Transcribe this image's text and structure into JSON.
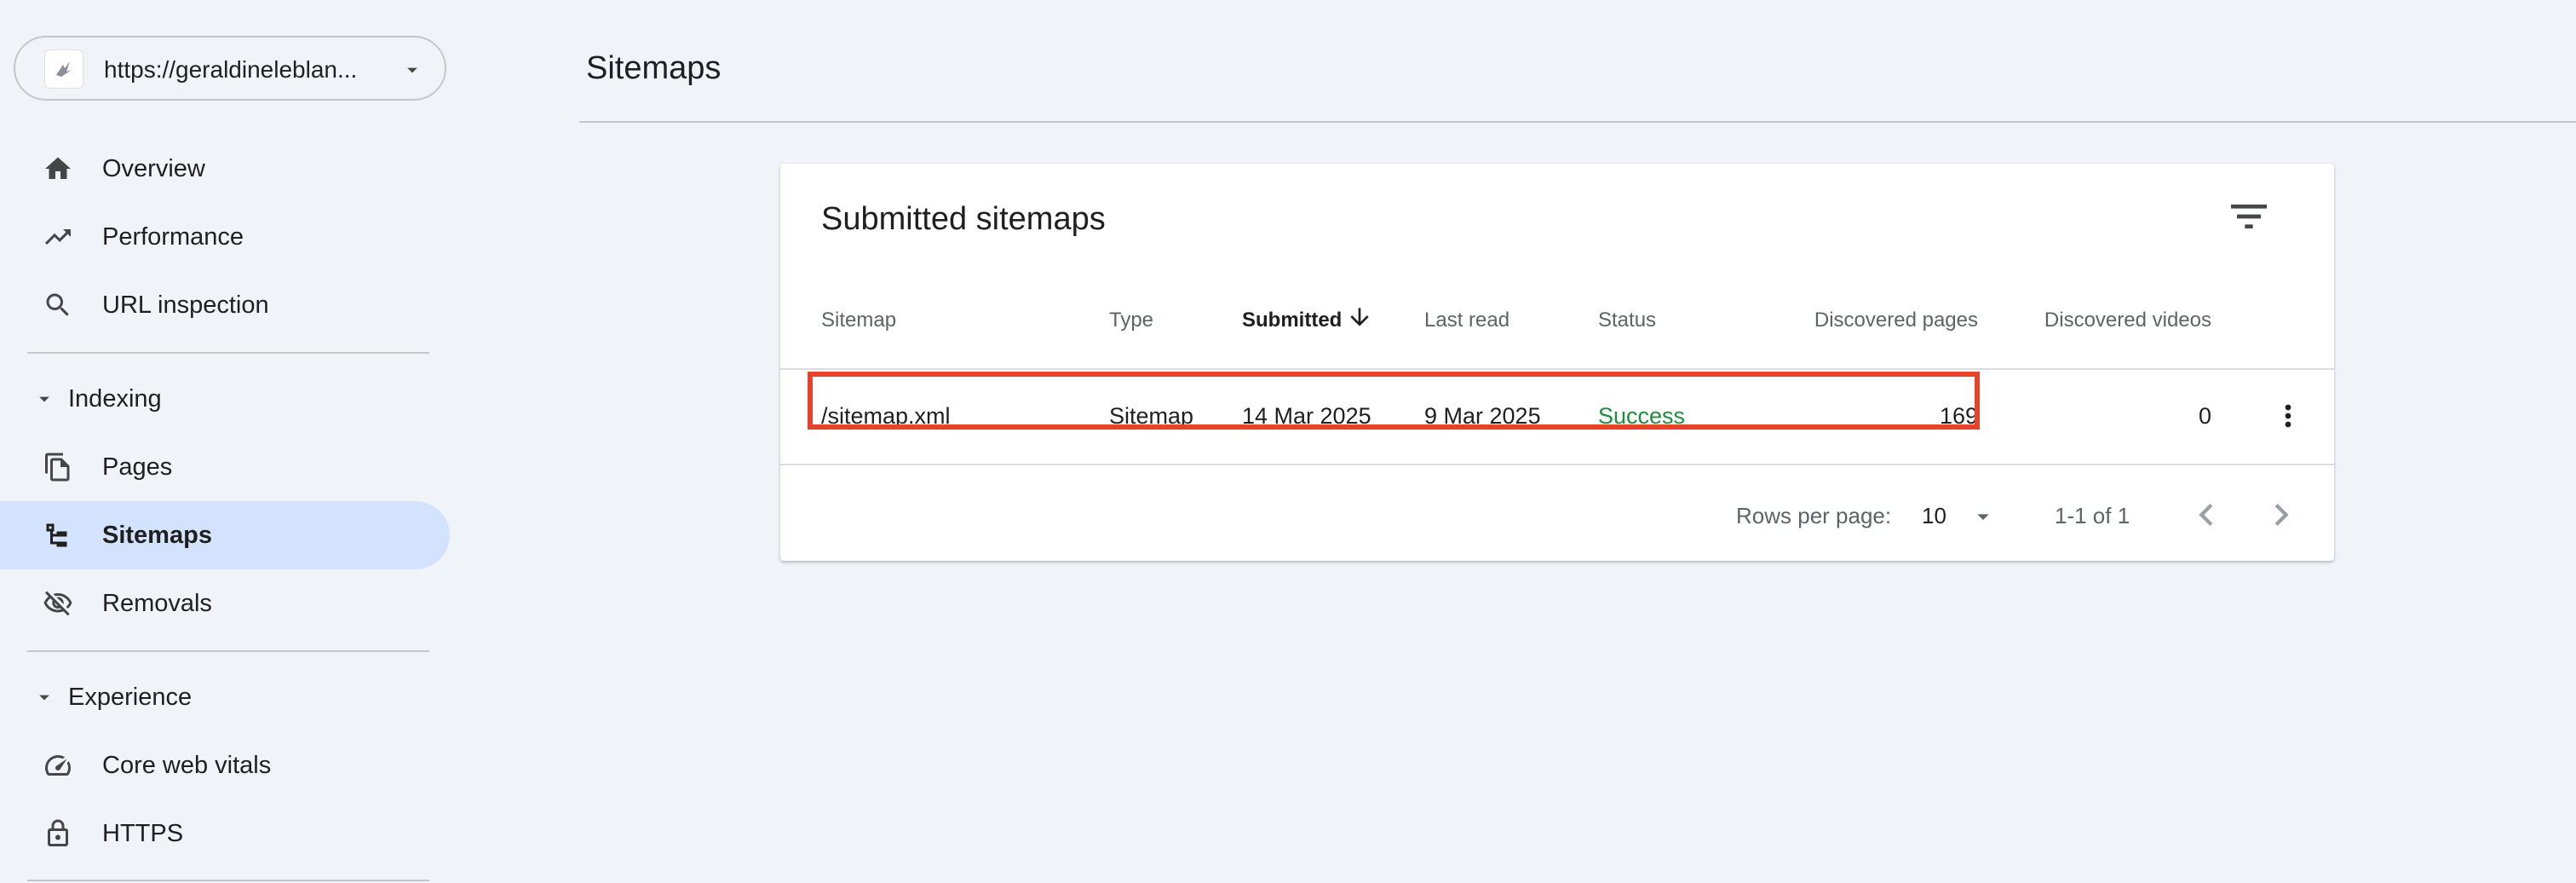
{
  "property": {
    "url": "https://geraldineleblan...",
    "logo_icon": "property-favicon-icon",
    "dropdown_icon": "chevron-down-icon"
  },
  "nav": {
    "overview": "Overview",
    "performance": "Performance",
    "url_inspection": "URL inspection",
    "indexing_section": "Indexing",
    "pages": "Pages",
    "sitemaps": "Sitemaps",
    "removals": "Removals",
    "experience_section": "Experience",
    "core_web_vitals": "Core web vitals",
    "https": "HTTPS",
    "active_item": "Sitemaps"
  },
  "page": {
    "title": "Sitemaps"
  },
  "card": {
    "title": "Submitted sitemaps",
    "columns": {
      "sitemap": "Sitemap",
      "type": "Type",
      "submitted": "Submitted",
      "last_read": "Last read",
      "status": "Status",
      "discovered_pages": "Discovered pages",
      "discovered_videos": "Discovered videos"
    },
    "sorted_column": "Submitted",
    "sort_direction": "descending",
    "rows": [
      {
        "sitemap": "/sitemap.xml",
        "type": "Sitemap",
        "submitted": "14 Mar 2025",
        "last_read": "9 Mar 2025",
        "status": "Success",
        "discovered_pages": "169",
        "discovered_videos": "0"
      }
    ],
    "footer": {
      "rows_per_page_label": "Rows per page:",
      "rows_per_page_value": "10",
      "range": "1-1 of 1"
    }
  },
  "colors": {
    "background": "#f0f4f9",
    "active_nav": "#d3e3fd",
    "success": "#1e8e3e",
    "highlight_box": "#e8412c"
  }
}
